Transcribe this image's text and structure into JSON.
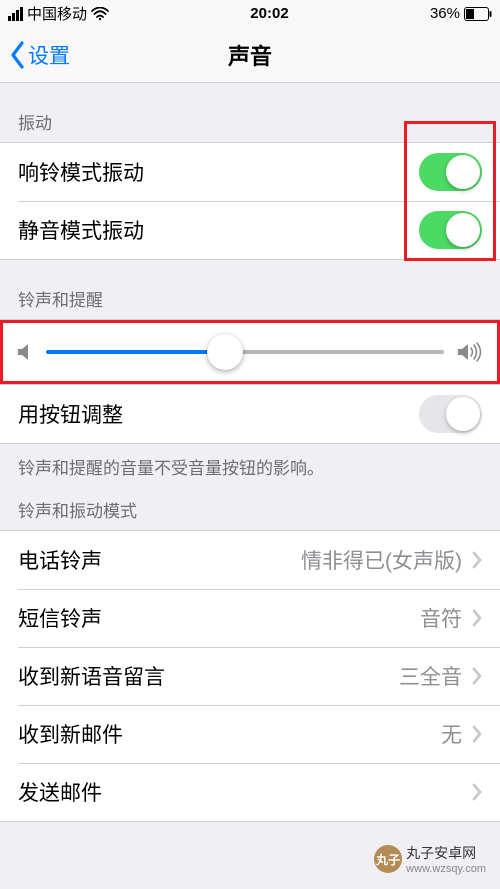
{
  "status": {
    "carrier": "中国移动",
    "time": "20:02",
    "battery": "36%"
  },
  "nav": {
    "back_label": "设置",
    "title": "声音"
  },
  "sections": {
    "vibrate": {
      "header": "振动",
      "ring_vibrate": {
        "label": "响铃模式振动",
        "on": true
      },
      "silent_vibrate": {
        "label": "静音模式振动",
        "on": true
      }
    },
    "ringer": {
      "header": "铃声和提醒",
      "slider_value": 0.45,
      "button_adjust": {
        "label": "用按钮调整",
        "on": false
      },
      "footer": "铃声和提醒的音量不受音量按钮的影响。"
    },
    "patterns": {
      "header": "铃声和振动模式",
      "items": [
        {
          "label": "电话铃声",
          "detail": "情非得已(女声版)"
        },
        {
          "label": "短信铃声",
          "detail": "音符"
        },
        {
          "label": "收到新语音留言",
          "detail": "三全音"
        },
        {
          "label": "收到新邮件",
          "detail": "无"
        },
        {
          "label": "发送邮件",
          "detail": ""
        }
      ]
    }
  },
  "watermark": {
    "logo_text": "丸子",
    "name": "丸子安卓网",
    "url": "www.wzsqy.com"
  }
}
